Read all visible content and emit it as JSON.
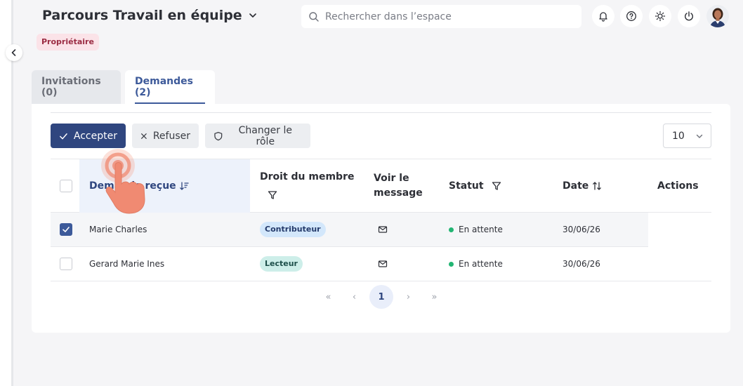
{
  "header": {
    "title": "Parcours Travail en équipe",
    "role_badge": "Propriétaire",
    "search_placeholder": "Rechercher dans l’espace",
    "icons": [
      "bell-icon",
      "help-icon",
      "sun-icon",
      "power-icon"
    ]
  },
  "tabs": [
    {
      "label": "Invitations (0)",
      "active": false
    },
    {
      "label": "Demandes (2)",
      "active": true
    }
  ],
  "toolbar": {
    "accept_label": "Accepter",
    "refuse_label": "Refuser",
    "change_role_label": "Changer le rôle",
    "page_size": "10"
  },
  "table": {
    "columns": {
      "requester": "Demande reçue",
      "member_right": "Droit du membre",
      "message": "Voir le message",
      "status": "Statut",
      "date": "Date",
      "actions": "Actions"
    },
    "rows": [
      {
        "name": "Marie Charles",
        "role": "Contributeur",
        "status": "En attente",
        "date": "30/06/26",
        "checked": true
      },
      {
        "name": "Gerard Marie Ines",
        "role": "Lecteur",
        "status": "En attente",
        "date": "30/06/26",
        "checked": false
      }
    ]
  },
  "pagination": {
    "first": "«",
    "prev": "‹",
    "current": "1",
    "next": "›",
    "last": "»"
  },
  "colors": {
    "primary": "#2f467f",
    "tab_active": "#3d5a9a",
    "badge_bg": "#fbe3e8",
    "status_dot": "#22b573",
    "hand": "#f08a72"
  }
}
